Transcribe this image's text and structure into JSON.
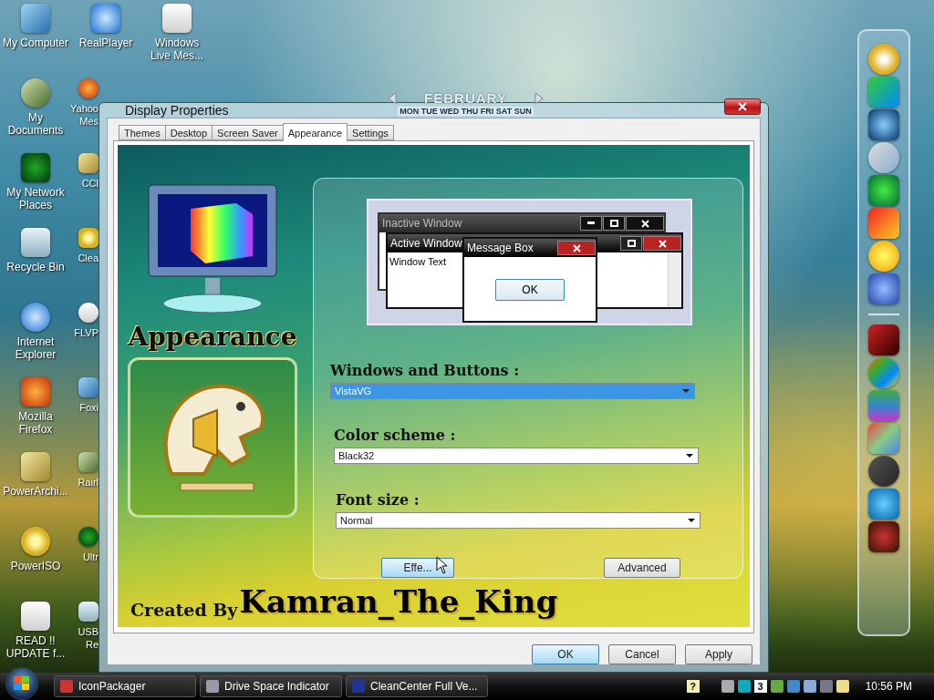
{
  "desktop": {
    "icon_columns": [
      {
        "icons": [
          {
            "lines": [
              "My Computer"
            ]
          },
          {
            "lines": [
              "My",
              "Documents"
            ]
          },
          {
            "lines": [
              "My Network",
              "Places"
            ]
          },
          {
            "lines": [
              "Recycle Bin"
            ]
          },
          {
            "lines": [
              "Internet",
              "Explorer"
            ]
          },
          {
            "lines": [
              "Mozilla",
              "Firefox"
            ]
          },
          {
            "lines": [
              "PowerArchi..."
            ]
          },
          {
            "lines": [
              "PowerISO"
            ]
          },
          {
            "lines": [
              "READ !!",
              "UPDATE f..."
            ]
          }
        ]
      },
      {
        "icons": [
          {
            "lines": [
              "RealPlayer"
            ]
          },
          {
            "lines": [
              "Yahoo",
              "Mes"
            ]
          },
          {
            "lines": [
              "CCl"
            ]
          },
          {
            "lines": [
              "Clea"
            ]
          },
          {
            "lines": [
              "FLVP"
            ]
          },
          {
            "lines": [
              "Foxi"
            ]
          },
          {
            "lines": [
              "Rairl"
            ]
          },
          {
            "lines": [
              "Ultr"
            ]
          },
          {
            "lines": [
              "USB",
              "Re"
            ]
          }
        ]
      },
      {
        "icons": [
          {
            "lines": [
              "Windows",
              "Live Mes..."
            ]
          }
        ]
      }
    ]
  },
  "calendar_gadget": {
    "month": "FEBRUARY",
    "weekdays": "MON TUE WED THU FRI SAT SUN"
  },
  "dialog": {
    "title": "Display Properties",
    "tabs": [
      {
        "label": "Themes",
        "selected": false
      },
      {
        "label": "Desktop",
        "selected": false
      },
      {
        "label": "Screen Saver",
        "selected": false
      },
      {
        "label": "Appearance",
        "selected": true
      },
      {
        "label": "Settings",
        "selected": false
      }
    ],
    "side_heading": "Appearance",
    "preview": {
      "inactive_title": "Inactive Window",
      "active_title": "Active Window",
      "window_text": "Window Text",
      "message_title": "Message Box",
      "message_button": "OK"
    },
    "fields": [
      {
        "label": "Windows and Buttons :",
        "value": "VistaVG",
        "selected": true
      },
      {
        "label": "Color scheme :",
        "value": "Black32",
        "selected": false
      },
      {
        "label": "Font size :",
        "value": "Normal",
        "selected": false
      }
    ],
    "panel_buttons": [
      {
        "label": "Effe...",
        "focused": true
      },
      {
        "label": "Advanced",
        "focused": false
      }
    ],
    "credit": {
      "prefix": "Created By",
      "name": "Kamran_The_King"
    },
    "buttons": [
      {
        "label": "OK",
        "focused": true
      },
      {
        "label": "Cancel",
        "focused": false
      },
      {
        "label": "Apply",
        "focused": false
      }
    ]
  },
  "taskbar": {
    "tasks": [
      "IconPackager",
      "Drive Space Indicator",
      "CleanCenter Full Ve..."
    ],
    "tray_help": "?",
    "tray_badge": "3",
    "clock": "10:56 PM"
  }
}
